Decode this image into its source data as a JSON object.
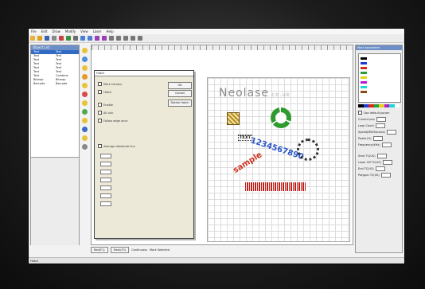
{
  "menu": {
    "items": [
      "File",
      "Edit",
      "Draw",
      "Modify",
      "View",
      "Laser",
      "Help"
    ]
  },
  "left_panel": {
    "title": "Object List",
    "rows": [
      {
        "name": "Text",
        "type": "Text"
      },
      {
        "name": "Text",
        "type": "Text"
      },
      {
        "name": "Text",
        "type": "Text"
      },
      {
        "name": "Text",
        "type": "Text"
      },
      {
        "name": "Text",
        "type": "Text"
      },
      {
        "name": "Text",
        "type": "Text"
      },
      {
        "name": "Text",
        "type": "Combine"
      },
      {
        "name": "Bitmap",
        "type": "Bitmap"
      },
      {
        "name": "Barcode",
        "type": "Barcode"
      }
    ]
  },
  "dialog": {
    "title": "Hatch",
    "options": [
      "Mark Contour",
      "Hatch",
      "Enable",
      "All calc",
      "Follow edge once",
      "Average distribute line"
    ],
    "buttons": [
      "OK",
      "Cancel",
      "Delete Hatch"
    ]
  },
  "canvas": {
    "logo_main": "Neolase",
    "logo_domain": ".co.uk",
    "numbers": "1234567890",
    "small_text": "TEXT",
    "sample": "sample"
  },
  "right_panel": {
    "title": "Mark parameter",
    "fields": [
      "Use default param",
      "Current pen",
      "Loop Count",
      "Speed(MM/Second)",
      "Power(%)",
      "Frequency(KHz)",
      "Start TC(US)",
      "Laser Off TC(US)",
      "End TC(US)",
      "Polygon TC(US)"
    ]
  },
  "bottom_bar": {
    "buttons": [
      "Red(F1)",
      "Mark(F2)"
    ],
    "checks": [
      "Continuous",
      "Mark Selected"
    ]
  },
  "statusbar": {
    "text": "Hatch"
  },
  "colors": {
    "accent": "#316ac5",
    "panel_head": "#6c8fc7",
    "bezel": "#1c1c1c"
  }
}
